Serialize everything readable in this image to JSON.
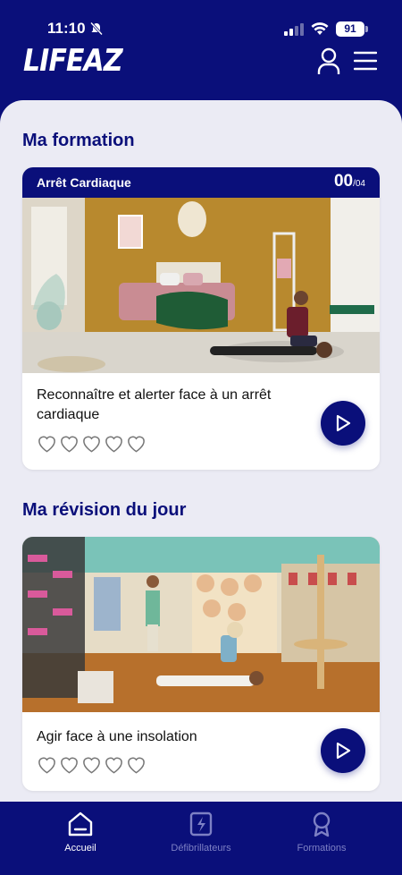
{
  "status_bar": {
    "time": "11:10",
    "battery": "91"
  },
  "header": {
    "logo": "LIFEAZ"
  },
  "section_formation": {
    "title": "Ma formation"
  },
  "card_formation": {
    "category": "Arrêt Cardiaque",
    "progress_current": "00",
    "progress_total": "/04",
    "title": "Reconnaître et alerter face à un arrêt cardiaque",
    "rating": 0,
    "max_rating": 5
  },
  "section_revision": {
    "title": "Ma révision du jour"
  },
  "card_revision": {
    "title": "Agir face à une insolation",
    "rating": 0,
    "max_rating": 5
  },
  "tabs": [
    {
      "label": "Accueil",
      "icon": "home-icon",
      "active": true
    },
    {
      "label": "Défibrillateurs",
      "icon": "defibrillator-icon",
      "active": false
    },
    {
      "label": "Formations",
      "icon": "award-icon",
      "active": false
    }
  ],
  "colors": {
    "primary": "#0a0f7a",
    "background": "#ebebf4",
    "inactive_tab": "#7d80c4"
  }
}
